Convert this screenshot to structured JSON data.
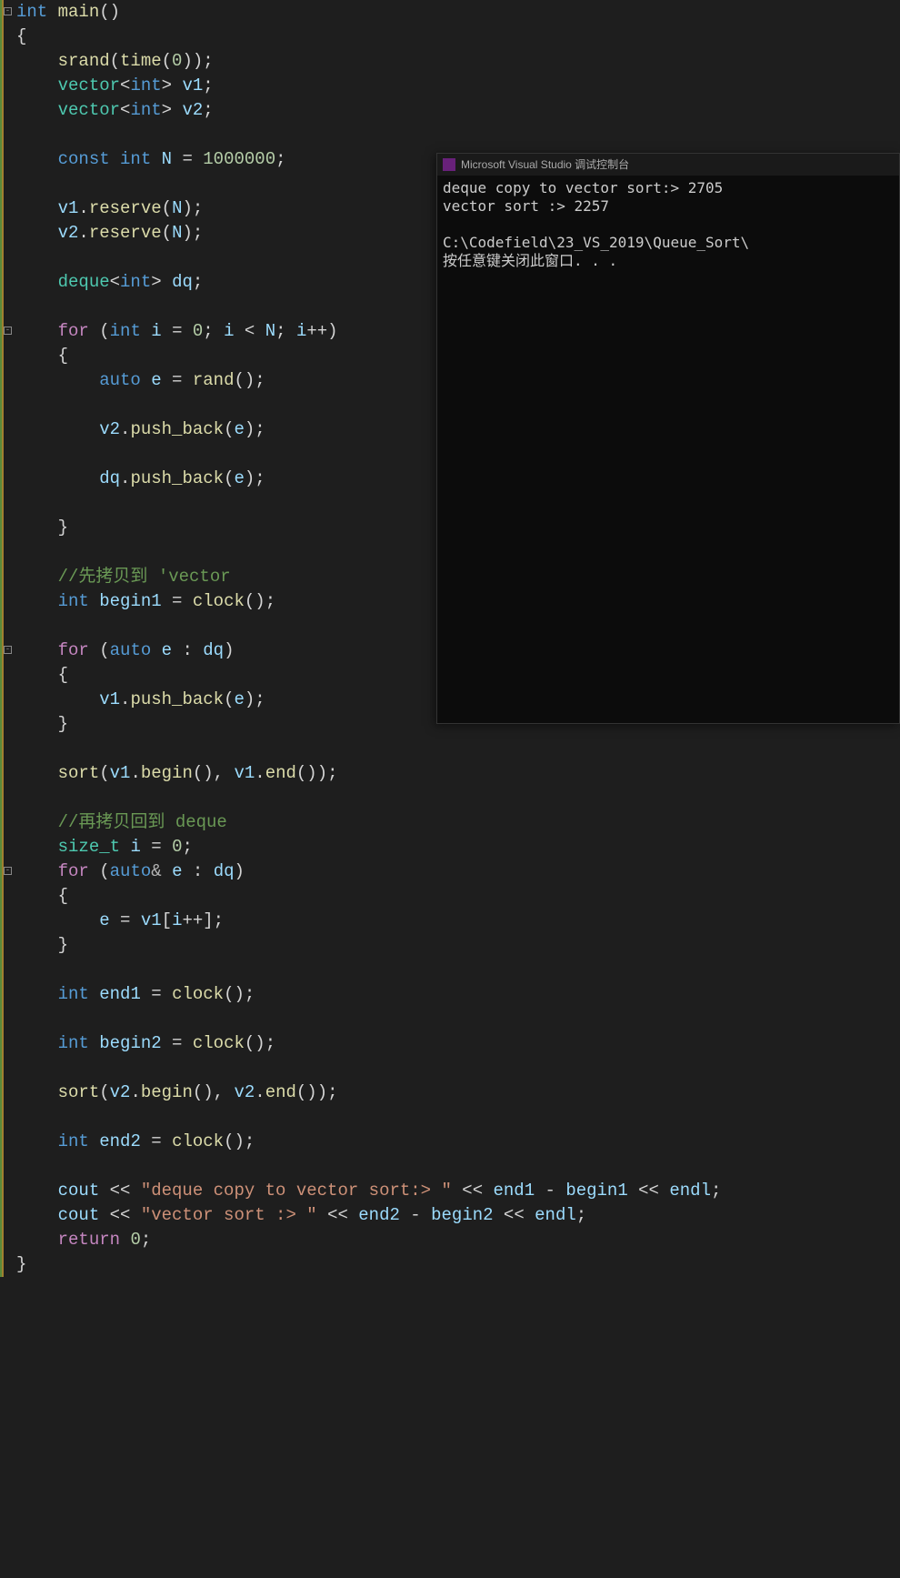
{
  "code": {
    "l1_int": "int",
    "l1_main": "main",
    "l1_rest": "()",
    "srand_fn": "srand",
    "time_fn": "time",
    "vector_t": "vector",
    "int_t": "int",
    "v1": "v1",
    "v2": "v2",
    "const_kw": "const",
    "N": "N",
    "N_val": "1000000",
    "reserve_fn": "reserve",
    "deque_t": "deque",
    "dq": "dq",
    "for_kw": "for",
    "i": "i",
    "zero": "0",
    "ipp": "i++",
    "auto_kw": "auto",
    "e": "e",
    "rand_fn": "rand",
    "push_back_fn": "push_back",
    "comment1": "//先拷贝到 'vector",
    "begin1": "begin1",
    "clock_fn": "clock",
    "sort_fn": "sort",
    "begin_fn": "begin",
    "end_fn": "end",
    "comment2": "//再拷贝回到 deque",
    "size_t": "size_t",
    "end1": "end1",
    "begin2": "begin2",
    "end2": "end2",
    "cout": "cout",
    "str1": "\"deque copy to vector sort:> \"",
    "str2": "\"vector sort :> \"",
    "endl": "endl",
    "return_kw": "return",
    "amp": "&"
  },
  "console": {
    "title": "Microsoft Visual Studio 调试控制台",
    "line1": "deque copy to vector sort:> 2705",
    "line2": "vector sort :> 2257",
    "line3": "",
    "line4": "C:\\Codefield\\23_VS_2019\\Queue_Sort\\",
    "line5": "按任意键关闭此窗口. . ."
  }
}
